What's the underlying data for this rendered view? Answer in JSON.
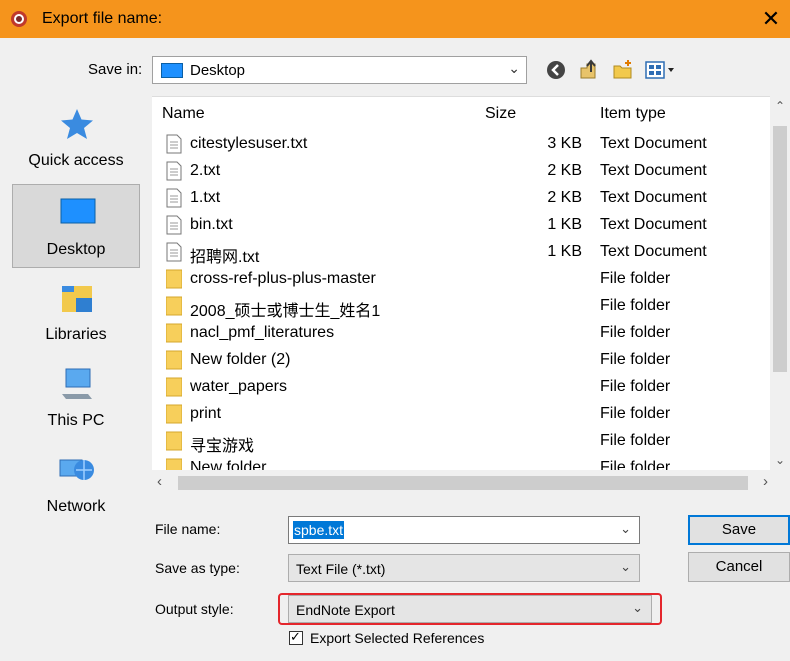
{
  "window": {
    "title": "Export file name:",
    "close_glyph": "✕"
  },
  "save_in": {
    "label": "Save in:",
    "value": "Desktop"
  },
  "places": [
    {
      "label": "Quick access",
      "icon": "star-icon"
    },
    {
      "label": "Desktop",
      "icon": "desktop-icon",
      "selected": true
    },
    {
      "label": "Libraries",
      "icon": "libraries-icon"
    },
    {
      "label": "This PC",
      "icon": "computer-icon"
    },
    {
      "label": "Network",
      "icon": "network-icon"
    }
  ],
  "columns": {
    "name": "Name",
    "size": "Size",
    "type": "Item type"
  },
  "files": [
    {
      "name": "citestylesuser.txt",
      "size": "3 KB",
      "type": "Text Document",
      "kind": "doc"
    },
    {
      "name": "2.txt",
      "size": "2 KB",
      "type": "Text Document",
      "kind": "doc"
    },
    {
      "name": "1.txt",
      "size": "2 KB",
      "type": "Text Document",
      "kind": "doc"
    },
    {
      "name": "bin.txt",
      "size": "1 KB",
      "type": "Text Document",
      "kind": "doc"
    },
    {
      "name": "招聘网.txt",
      "size": "1 KB",
      "type": "Text Document",
      "kind": "doc"
    },
    {
      "name": "cross-ref-plus-plus-master",
      "size": "",
      "type": "File folder",
      "kind": "folder"
    },
    {
      "name": "2008_硕士或博士生_姓名1",
      "size": "",
      "type": "File folder",
      "kind": "folder"
    },
    {
      "name": "nacl_pmf_literatures",
      "size": "",
      "type": "File folder",
      "kind": "folder"
    },
    {
      "name": "New folder (2)",
      "size": "",
      "type": "File folder",
      "kind": "folder"
    },
    {
      "name": "water_papers",
      "size": "",
      "type": "File folder",
      "kind": "folder"
    },
    {
      "name": "print",
      "size": "",
      "type": "File folder",
      "kind": "folder"
    },
    {
      "name": "寻宝游戏",
      "size": "",
      "type": "File folder",
      "kind": "folder"
    },
    {
      "name": "New folder",
      "size": "",
      "type": "File folder",
      "kind": "folder"
    }
  ],
  "form": {
    "file_name_label": "File name:",
    "file_name_value": "spbe.txt",
    "save_as_type_label": "Save as type:",
    "save_as_type_value": "Text File (*.txt)",
    "output_style_label": "Output style:",
    "output_style_value": "EndNote Export",
    "export_selected_label": "Export Selected References",
    "export_selected_checked": true
  },
  "buttons": {
    "save": "Save",
    "cancel": "Cancel"
  },
  "colors": {
    "titlebar": "#f5941c",
    "highlight": "#e4262c",
    "selection": "#0078d7"
  }
}
